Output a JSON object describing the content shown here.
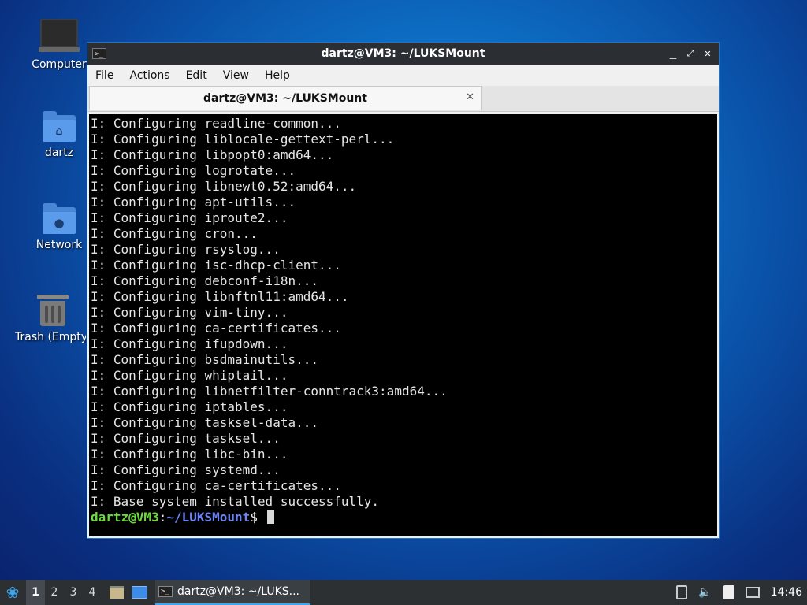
{
  "desktop": {
    "icons": [
      {
        "label": "Computer"
      },
      {
        "label": "dartz"
      },
      {
        "label": "Network"
      },
      {
        "label": "Trash (Empty)"
      }
    ]
  },
  "window": {
    "title": "dartz@VM3: ~/LUKSMount",
    "menu": [
      "File",
      "Actions",
      "Edit",
      "View",
      "Help"
    ],
    "tab_title": "dartz@VM3: ~/LUKSMount",
    "terminal_lines": [
      "I: Configuring readline-common...",
      "I: Configuring liblocale-gettext-perl...",
      "I: Configuring libpopt0:amd64...",
      "I: Configuring logrotate...",
      "I: Configuring libnewt0.52:amd64...",
      "I: Configuring apt-utils...",
      "I: Configuring iproute2...",
      "I: Configuring cron...",
      "I: Configuring rsyslog...",
      "I: Configuring isc-dhcp-client...",
      "I: Configuring debconf-i18n...",
      "I: Configuring libnftnl11:amd64...",
      "I: Configuring vim-tiny...",
      "I: Configuring ca-certificates...",
      "I: Configuring ifupdown...",
      "I: Configuring bsdmainutils...",
      "I: Configuring whiptail...",
      "I: Configuring libnetfilter-conntrack3:amd64...",
      "I: Configuring iptables...",
      "I: Configuring tasksel-data...",
      "I: Configuring tasksel...",
      "I: Configuring libc-bin...",
      "I: Configuring systemd...",
      "I: Configuring ca-certificates...",
      "I: Base system installed successfully."
    ],
    "prompt_user": "dartz@VM3",
    "prompt_colon": ":",
    "prompt_path": "~/LUKSMount",
    "prompt_symbol": "$"
  },
  "taskbar": {
    "workspaces": [
      "1",
      "2",
      "3",
      "4"
    ],
    "active_workspace": "1",
    "task_label": "dartz@VM3: ~/LUKS...",
    "clock": "14:46"
  },
  "icons": {
    "start": "lxqt-start-icon",
    "volume": "volume-icon",
    "terminal": "terminal-icon"
  }
}
